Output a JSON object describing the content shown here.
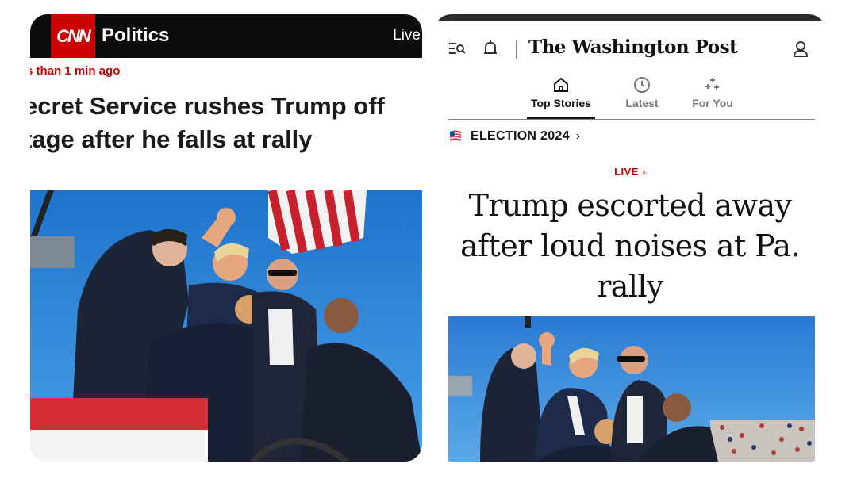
{
  "cnn": {
    "logo": "CNN",
    "section": "Politics",
    "live": "Live",
    "timestamp": "s than 1 min ago",
    "headline_line1": "ecret Service rushes Trump off",
    "headline_line2": "tage after he falls at rally",
    "colors": {
      "brand_red": "#cc0000",
      "header_bg": "#0c0c0c"
    }
  },
  "wapo": {
    "masthead": "The Washington Post",
    "tabs": [
      {
        "label": "Top Stories",
        "icon": "home-icon",
        "active": true
      },
      {
        "label": "Latest",
        "icon": "clock-icon",
        "active": false
      },
      {
        "label": "For You",
        "icon": "sparkle-icon",
        "active": false
      }
    ],
    "kicker": "ELECTION 2024",
    "live": "LIVE",
    "headline": "Trump escorted away after loud noises at Pa. rally",
    "colors": {
      "live_red": "#cc0000"
    }
  }
}
